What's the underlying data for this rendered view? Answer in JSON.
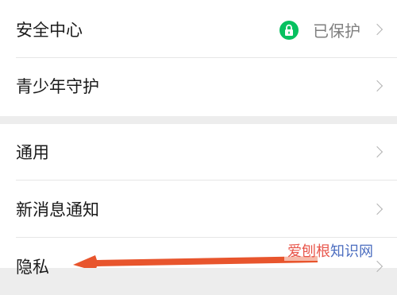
{
  "settings_top": {
    "security": {
      "label": "安全中心",
      "status": "已保护",
      "status_icon": "lock-icon",
      "status_color": "#07c160"
    },
    "youth": {
      "label": "青少年守护"
    }
  },
  "settings_bottom": {
    "general": {
      "label": "通用"
    },
    "notifications": {
      "label": "新消息通知"
    },
    "privacy": {
      "label": "隐私"
    }
  },
  "annotation": {
    "arrow_color": "#e8552d"
  },
  "watermark": {
    "brand": "爱刨根",
    "rest": "知识网"
  }
}
